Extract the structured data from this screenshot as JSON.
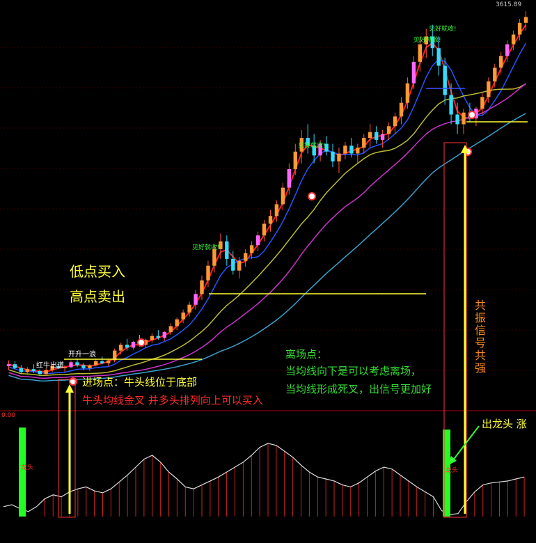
{
  "price_label": "3615.89",
  "indicator_top_label": "0.00",
  "annotations": {
    "strategy_line1": "低点买入",
    "strategy_line2": "高点卖出",
    "entry_line1": "进场点：牛头线位于底部",
    "entry_line2": "牛头均线金叉 并多头排列向上可以买入",
    "exit_title": "离场点：",
    "exit_line1": "当均线向下是可以考虑离场，",
    "exit_line2": "当均线形成死叉，出信号更加好",
    "resonance": "共振信号共强",
    "dragon_head": "出龙头 涨",
    "red_bull": "红牛出道",
    "kick_off": "开升一浪",
    "signal_text": "见好就收!",
    "indicator_small": "龙头"
  },
  "colors": {
    "up": "#ff3030",
    "down": "#33ddff",
    "ma_red": "#ff2020",
    "ma_blue": "#2255ff",
    "ma_yellow": "#bbbb33",
    "ma_purple": "#cc33cc",
    "ma_cyan": "#3aa0cc",
    "signal_yellow": "#ffff33",
    "bar_green": "#22ff22",
    "grid": "#3a0000"
  },
  "chart_data": {
    "type": "candlestick",
    "price_max_label": 3615.89,
    "candles": [
      [
        102,
        108,
        98,
        104
      ],
      [
        104,
        107,
        99,
        100
      ],
      [
        100,
        103,
        94,
        96
      ],
      [
        96,
        101,
        93,
        99
      ],
      [
        99,
        104,
        95,
        97
      ],
      [
        97,
        99,
        92,
        94
      ],
      [
        94,
        100,
        92,
        98
      ],
      [
        98,
        104,
        96,
        102
      ],
      [
        102,
        106,
        99,
        100
      ],
      [
        100,
        103,
        96,
        101
      ],
      [
        101,
        108,
        100,
        106
      ],
      [
        106,
        110,
        101,
        103
      ],
      [
        103,
        105,
        98,
        100
      ],
      [
        100,
        104,
        97,
        103
      ],
      [
        103,
        109,
        102,
        107
      ],
      [
        107,
        112,
        104,
        105
      ],
      [
        105,
        110,
        102,
        108
      ],
      [
        108,
        120,
        106,
        118
      ],
      [
        118,
        126,
        114,
        124
      ],
      [
        124,
        130,
        118,
        121
      ],
      [
        121,
        128,
        119,
        127
      ],
      [
        127,
        134,
        122,
        124
      ],
      [
        124,
        130,
        121,
        129
      ],
      [
        129,
        136,
        126,
        133
      ],
      [
        133,
        139,
        129,
        131
      ],
      [
        131,
        138,
        128,
        137
      ],
      [
        137,
        146,
        134,
        143
      ],
      [
        143,
        152,
        139,
        150
      ],
      [
        150,
        160,
        146,
        157
      ],
      [
        157,
        168,
        153,
        165
      ],
      [
        165,
        180,
        160,
        176
      ],
      [
        176,
        195,
        170,
        190
      ],
      [
        190,
        210,
        183,
        205
      ],
      [
        205,
        225,
        198,
        222
      ],
      [
        222,
        238,
        212,
        230
      ],
      [
        230,
        236,
        205,
        212
      ],
      [
        212,
        220,
        196,
        200
      ],
      [
        200,
        214,
        192,
        210
      ],
      [
        210,
        222,
        204,
        218
      ],
      [
        218,
        230,
        212,
        226
      ],
      [
        226,
        240,
        220,
        236
      ],
      [
        236,
        252,
        230,
        248
      ],
      [
        248,
        262,
        240,
        256
      ],
      [
        256,
        272,
        250,
        268
      ],
      [
        268,
        290,
        262,
        285
      ],
      [
        285,
        310,
        278,
        304
      ],
      [
        304,
        330,
        298,
        322
      ],
      [
        322,
        344,
        310,
        336
      ],
      [
        336,
        350,
        320,
        328
      ],
      [
        328,
        340,
        310,
        318
      ],
      [
        318,
        334,
        312,
        330
      ],
      [
        330,
        338,
        318,
        322
      ],
      [
        322,
        330,
        306,
        312
      ],
      [
        312,
        326,
        300,
        320
      ],
      [
        320,
        332,
        314,
        328
      ],
      [
        328,
        336,
        316,
        320
      ],
      [
        320,
        330,
        310,
        326
      ],
      [
        326,
        340,
        320,
        336
      ],
      [
        336,
        350,
        326,
        342
      ],
      [
        342,
        348,
        330,
        334
      ],
      [
        334,
        344,
        326,
        340
      ],
      [
        340,
        352,
        334,
        348
      ],
      [
        348,
        362,
        340,
        358
      ],
      [
        358,
        378,
        350,
        372
      ],
      [
        372,
        398,
        366,
        392
      ],
      [
        392,
        420,
        386,
        414
      ],
      [
        414,
        440,
        404,
        432
      ],
      [
        432,
        448,
        418,
        440
      ],
      [
        440,
        452,
        420,
        428
      ],
      [
        428,
        440,
        400,
        410
      ],
      [
        410,
        418,
        370,
        380
      ],
      [
        380,
        392,
        350,
        360
      ],
      [
        360,
        372,
        340,
        350
      ],
      [
        350,
        366,
        340,
        362
      ],
      [
        362,
        372,
        352,
        356
      ],
      [
        356,
        368,
        348,
        366
      ],
      [
        366,
        382,
        360,
        378
      ],
      [
        378,
        398,
        372,
        394
      ],
      [
        394,
        412,
        388,
        408
      ],
      [
        408,
        424,
        402,
        420
      ],
      [
        420,
        436,
        414,
        432
      ],
      [
        432,
        446,
        426,
        442
      ],
      [
        442,
        458,
        436,
        454
      ],
      [
        454,
        466,
        446,
        460
      ]
    ],
    "ma_series": [
      "red",
      "blue",
      "yellow",
      "purple",
      "cyan"
    ],
    "indicator": {
      "values": [
        0.1,
        0.12,
        0.08,
        0.05,
        0.1,
        0.18,
        0.22,
        0.2,
        0.25,
        0.28,
        0.3,
        0.26,
        0.24,
        0.28,
        0.35,
        0.42,
        0.5,
        0.58,
        0.62,
        0.55,
        0.45,
        0.38,
        0.3,
        0.28,
        0.32,
        0.36,
        0.4,
        0.45,
        0.5,
        0.55,
        0.62,
        0.7,
        0.74,
        0.72,
        0.66,
        0.6,
        0.52,
        0.45,
        0.4,
        0.38,
        0.36,
        0.32,
        0.3,
        0.34,
        0.4,
        0.46,
        0.5,
        0.48,
        0.42,
        0.36,
        0.3,
        0.25,
        0.2,
        0.06,
        0.02,
        0.03,
        0.15,
        0.25,
        0.32,
        0.34,
        0.35,
        0.36,
        0.38,
        0.4
      ],
      "dragon_bars": [
        0.9,
        0.88
      ]
    }
  }
}
